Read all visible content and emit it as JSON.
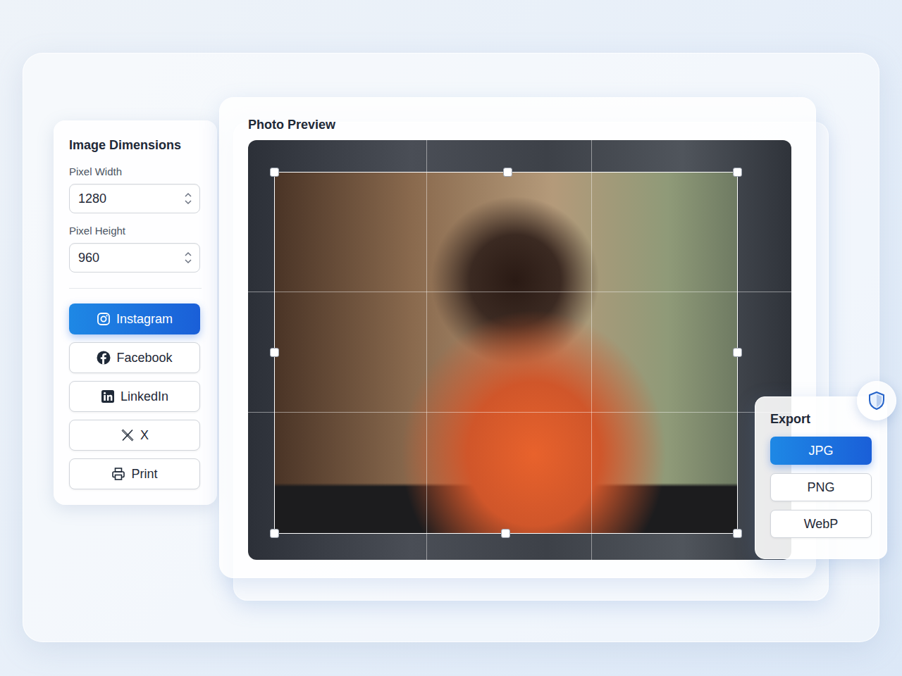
{
  "dimensions": {
    "title": "Image Dimensions",
    "width_label": "Pixel Width",
    "width": "1280",
    "height_label": "Pixel Height",
    "height": "960"
  },
  "presets": [
    {
      "label": "Instagram",
      "selected": true
    },
    {
      "label": "Facebook",
      "selected": false
    },
    {
      "label": "LinkedIn",
      "selected": false
    },
    {
      "label": "X",
      "selected": false
    },
    {
      "label": "Print",
      "selected": false
    }
  ],
  "preview": {
    "title": "Photo Preview"
  },
  "export": {
    "title": "Export",
    "formats": [
      {
        "label": "JPG",
        "selected": true
      },
      {
        "label": "PNG",
        "selected": false
      },
      {
        "label": "WebP",
        "selected": false
      }
    ]
  }
}
